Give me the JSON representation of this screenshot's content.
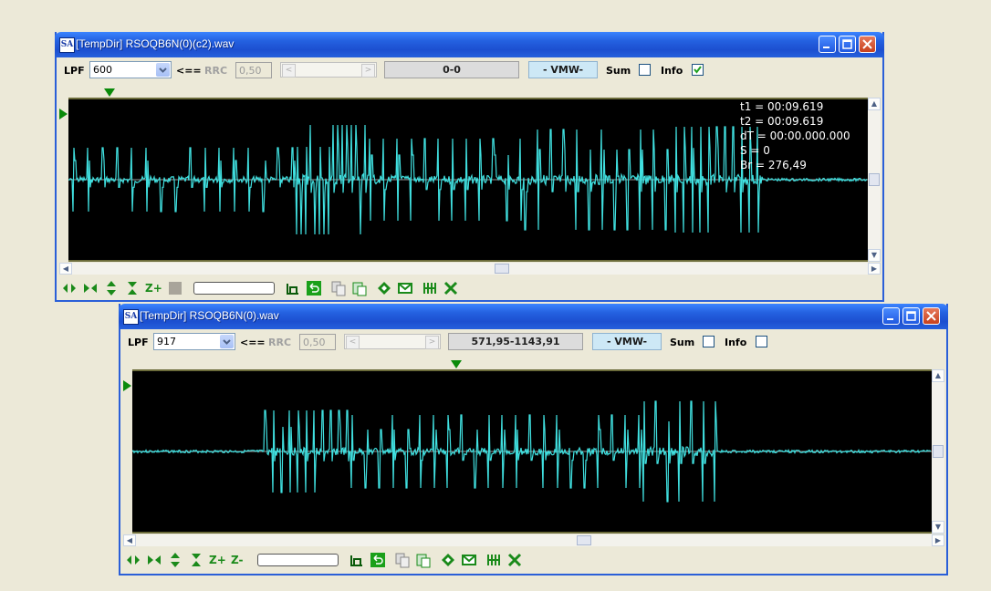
{
  "window1": {
    "title": "[TempDir] RSOQB6N(0)(c2).wav",
    "lpf_label": "LPF",
    "lpf_value": "600",
    "arrow_label": "<==",
    "rrc_label": "RRC",
    "rrc_value": "0,50",
    "range_value": "0-0",
    "vmw_label": "- VMW-",
    "sum_label": "Sum",
    "info_label": "Info",
    "sum_checked": false,
    "info_checked": true,
    "info_lines": {
      "t1": "t1 = 00:09.619",
      "t2": "t2 = 00:09.619",
      "dt": "dT = 00:00.000.000",
      "s": "S = 0",
      "br": "Br = 276,49"
    }
  },
  "window2": {
    "title": "[TempDir] RSOQB6N(0).wav",
    "lpf_label": "LPF",
    "lpf_value": "917",
    "arrow_label": "<==",
    "rrc_label": "RRC",
    "rrc_value": "0,50",
    "range_value": "571,95-1143,91",
    "vmw_label": "- VMW-",
    "sum_label": "Sum",
    "info_label": "Info",
    "sum_checked": false,
    "info_checked": false
  },
  "toolbar_icons": [
    "expand-horizontal-icon",
    "shrink-horizontal-icon",
    "expand-vertical-icon",
    "shrink-vertical-icon",
    "zoom-in-icon",
    "zoom-out-icon",
    "stop-icon",
    "crop-icon",
    "undo-icon",
    "copy-icon",
    "paste-icon",
    "diamond-icon",
    "envelope-icon",
    "grid-icon",
    "tools-icon"
  ],
  "toolbar_labels": {
    "zoom_in": "Z+",
    "zoom_out": "Z-"
  },
  "colors": {
    "waveform": "#40e0e0",
    "plot_background": "#000000",
    "marker": "#0a8a0a",
    "title_bar": "#2461e0"
  }
}
